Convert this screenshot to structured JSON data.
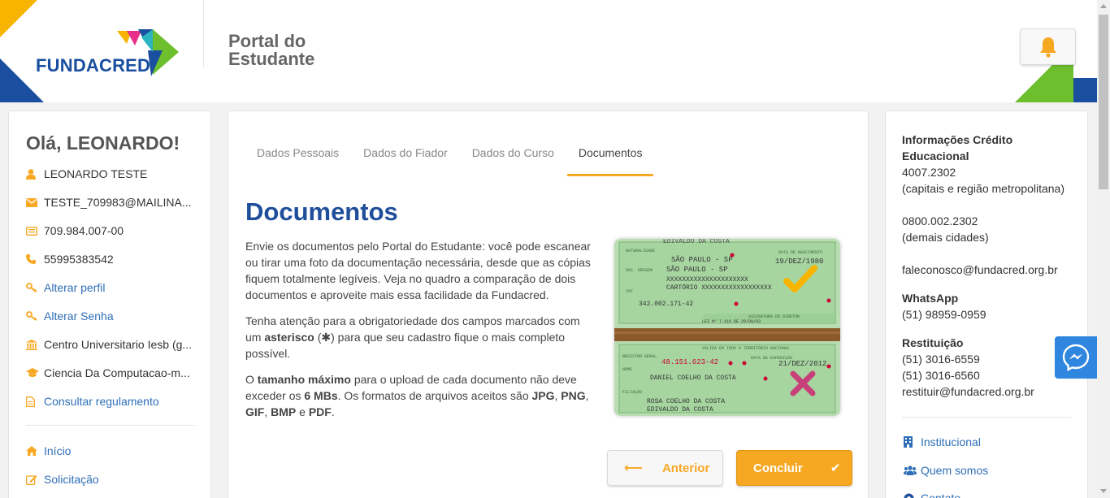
{
  "brand": {
    "logo_text": "FUNDACRED",
    "portal_title": "Portal do Estudante",
    "colors": {
      "blue": "#1f4e9b",
      "orange": "#f7a823",
      "green": "#6dbf2e",
      "yellow": "#f7b500",
      "link": "#2e6fb7"
    }
  },
  "header": {
    "notification_icon": "bell-icon"
  },
  "left": {
    "greeting": "Olá, LEONARDO!",
    "items": [
      {
        "icon": "user-icon",
        "label": "LEONARDO TESTE"
      },
      {
        "icon": "envelope-icon",
        "label": "TESTE_709983@MAILINA..."
      },
      {
        "icon": "id-card-icon",
        "label": "709.984.007-00"
      },
      {
        "icon": "phone-icon",
        "label": "55995383542"
      },
      {
        "icon": "key-icon",
        "label": "Alterar perfil"
      },
      {
        "icon": "key-icon",
        "label": "Alterar Senha"
      },
      {
        "icon": "institution-icon",
        "label": "Centro Universitario Iesb (g..."
      },
      {
        "icon": "graduation-cap-icon",
        "label": "Ciencia Da Computacao-m..."
      },
      {
        "icon": "document-icon",
        "label": "Consultar regulamento"
      },
      {
        "icon": "home-icon",
        "label": "Início"
      },
      {
        "icon": "edit-icon",
        "label": "Solicitação"
      }
    ]
  },
  "main": {
    "tabs": [
      {
        "label": "Dados Pessoais"
      },
      {
        "label": "Dados do Fiador"
      },
      {
        "label": "Dados do Curso"
      },
      {
        "label": "Documentos"
      }
    ],
    "active_tab": "Documentos",
    "title": "Documentos",
    "para1": "Envie os documentos pelo Portal do Estudante: você pode escanear ou tirar uma foto da documentação necessária, desde que as cópias fiquem totalmente legíveis. Veja no quadro a comparação de dois documentos e aproveite mais essa facilidade da Fundacred.",
    "para2": {
      "pre": "Tenha atenção para a obrigatoriedade dos campos marcados com um",
      "bold": "asterisco",
      "mid": "(",
      "star": "✱",
      "post": ") para que seu cadastro fique o mais completo possível."
    },
    "para3": {
      "pre": "O",
      "b1": "tamanho máximo",
      "t1": "para o upload de cada documento não deve exceder os",
      "b2": "6 MBs",
      "t2": ". Os formatos de arquivos aceitos são",
      "b3": "JPG",
      "t3": ",",
      "b4": "PNG",
      "t4": ",",
      "b5": "GIF",
      "t5": ",",
      "b6": "BMP",
      "t6": "e",
      "b7": "PDF",
      "t7": "."
    },
    "image": {
      "doc1": {
        "top_text": "EDIVALDO DA COSTA",
        "naturalidade_label": "NATURALIDADE",
        "naturalidade": "SÃO PAULO - SP",
        "nascimento_label": "DATA DE NASCIMENTO",
        "nascimento": "19/DEZ/1980",
        "origem_label": "DOC. ORIGEM",
        "origem": "SÃO PAULO - SP",
        "xline1": "XXXXXXXXXXXXXXXXXXXXX",
        "cartorio": "CARTÓRIO XXXXXXXXXXXXXXXXXX",
        "cpf_label": "CPF",
        "cpf": "342.002.171-42",
        "assinatura": "ASSINATURA DO DIRETOR",
        "lei": "LEI Nº 7.116 DE 29/08/83"
      },
      "doc2": {
        "valida": "VÁLIDA EM TODO O TERRITÓRIO NACIONAL",
        "registro_label": "REGISTRO GERAL",
        "registro": "48.151.623-42",
        "expedicao_label": "DATA DE EXPEDIÇÃO",
        "expedicao": "21/DEZ/2012",
        "nome_label": "NOME",
        "nome": "DANIEL COELHO DA COSTA",
        "filiacao_label": "FILIAÇÃO",
        "filiacao1": "ROSA COELHO DA COSTA",
        "filiacao2": "EDIVALDO DA COSTA"
      }
    },
    "btn_prev": {
      "label": "Anterior",
      "icon": "arrow-left-icon"
    },
    "btn_next": {
      "label": "Concluir",
      "icon": "check-icon"
    }
  },
  "right": {
    "credit_title": "Informações Crédito Educacional",
    "phone1": "4007.2302",
    "phone1_note": "(capitais e região metropolitana)",
    "phone2": "0800.002.2302",
    "phone2_note": "(demais cidades)",
    "email": "faleconosco@fundacred.org.br",
    "whatsapp_title": "WhatsApp",
    "whatsapp": "(51) 98959-0959",
    "restituicao_title": "Restituição",
    "rest_phone1": "(51) 3016-6559",
    "rest_phone2": "(51) 3016-6560",
    "rest_email": "restituir@fundacred.org.br",
    "links": [
      {
        "icon": "building-icon",
        "label": "Institucional"
      },
      {
        "icon": "users-icon",
        "label": "Quem somos"
      },
      {
        "icon": "contact-icon",
        "label": "Contato"
      }
    ]
  },
  "messenger": {
    "icon": "messenger-icon"
  }
}
